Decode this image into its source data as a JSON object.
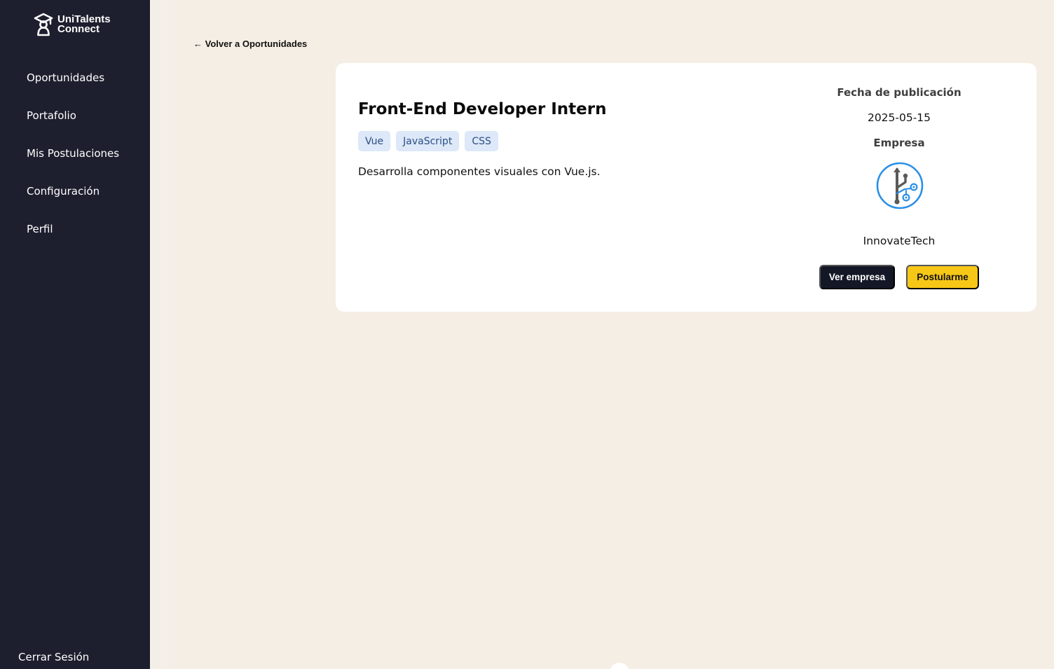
{
  "brand": {
    "line1": "UniTalents",
    "line2": "Connect",
    "icon": "graduate-logo-icon"
  },
  "sidebar": {
    "items": [
      {
        "label": "Oportunidades"
      },
      {
        "label": "Portafolio"
      },
      {
        "label": "Mis Postulaciones"
      },
      {
        "label": "Configuración"
      },
      {
        "label": "Perfil"
      }
    ],
    "logout_label": "Cerrar Sesión"
  },
  "main": {
    "back_link": "← Volver a Oportunidades",
    "job": {
      "title": "Front-End Developer Intern",
      "tags": [
        "Vue",
        "JavaScript",
        "CSS"
      ],
      "description": "Desarrolla componentes visuales con Vue.js."
    },
    "details": {
      "date_label": "Fecha de publicación",
      "date_value": "2025-05-15",
      "company_label": "Empresa",
      "company_name": "InnovateTech",
      "company_logo_icon": "usb-tech-logo-icon"
    },
    "actions": {
      "view_company": "Ver empresa",
      "apply": "Postularme"
    }
  },
  "colors": {
    "sidebar_bg": "#1e1f2e",
    "page_bg": "#f5eee5",
    "tag_bg": "#dde8f8",
    "tag_text": "#2b4f86",
    "primary_button": "#141826",
    "accent_button": "#f7c717",
    "logo_blue": "#2a8fe6"
  }
}
